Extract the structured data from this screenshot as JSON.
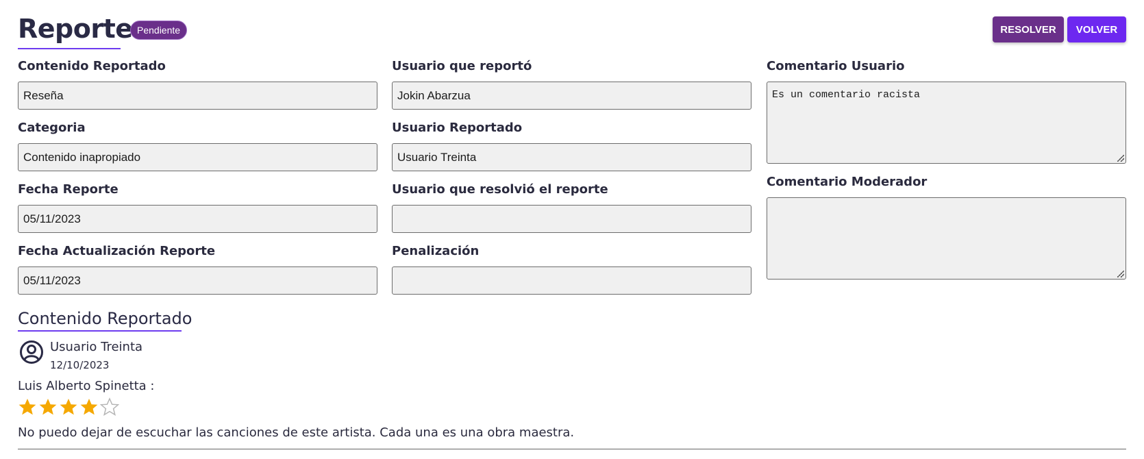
{
  "header": {
    "title": "Reporte",
    "status_badge": "Pendiente",
    "resolve_label": "RESOLVER",
    "back_label": "VOLVER"
  },
  "form": {
    "contenido_reportado": {
      "label": "Contenido Reportado",
      "value": "Reseña"
    },
    "categoria": {
      "label": "Categoria",
      "value": "Contenido inapropiado"
    },
    "fecha_reporte": {
      "label": "Fecha Reporte",
      "value": "05/11/2023"
    },
    "fecha_actualizacion": {
      "label": "Fecha Actualización Reporte",
      "value": "05/11/2023"
    },
    "usuario_reporto": {
      "label": "Usuario que reportó",
      "value": "Jokin Abarzua"
    },
    "usuario_reportado": {
      "label": "Usuario Reportado",
      "value": "Usuario Treinta"
    },
    "usuario_resolvio": {
      "label": "Usuario que resolvió el reporte",
      "value": ""
    },
    "penalizacion": {
      "label": "Penalización",
      "value": ""
    },
    "comentario_usuario": {
      "label": "Comentario Usuario",
      "value": "Es un comentario racista"
    },
    "comentario_moderador": {
      "label": "Comentario Moderador",
      "value": ""
    }
  },
  "reported_content": {
    "section_title": "Contenido Reportado",
    "user_name": "Usuario Treinta",
    "date": "12/10/2023",
    "artist": "Luis Alberto Spinetta :",
    "rating": 4,
    "rating_max": 5,
    "text": "No puedo dejar de escuchar las canciones de este artista. Cada una es una obra maestra."
  },
  "colors": {
    "accent": "#6d28f0",
    "resolve": "#6a2f8a",
    "star_filled": "#f5a800",
    "star_empty": "#b5b5b5"
  }
}
